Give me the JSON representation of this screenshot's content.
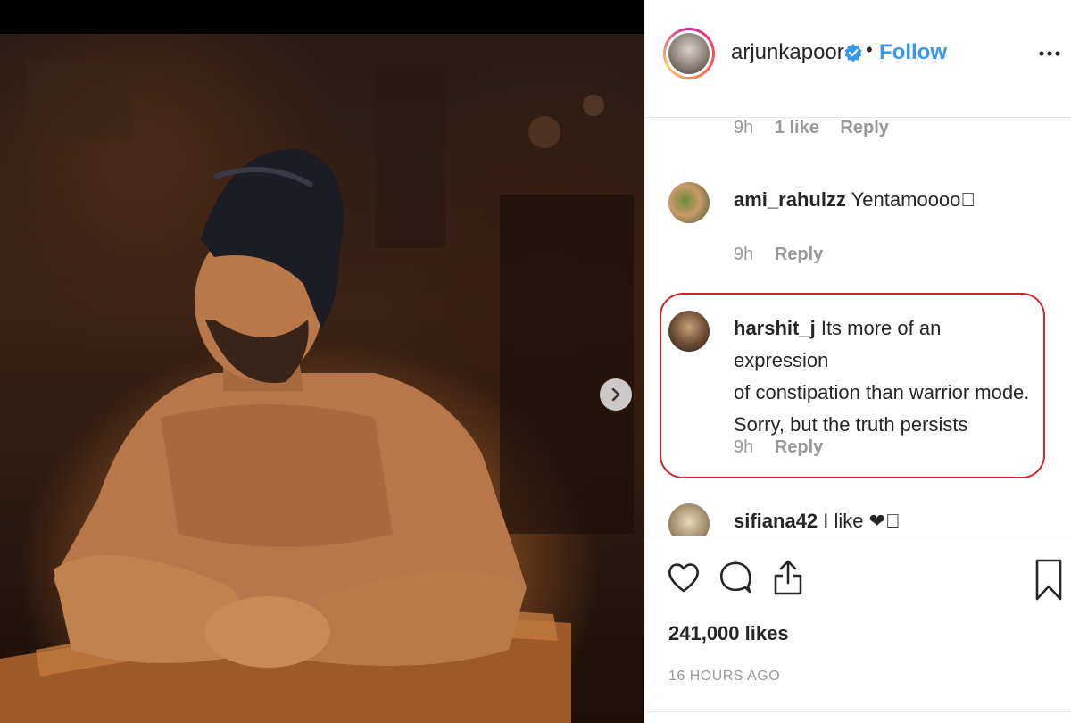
{
  "post": {
    "username": "arjunkapoor",
    "separator": "•",
    "follow_label": "Follow",
    "likes": "241,000 likes",
    "time_ago": "16 HOURS AGO"
  },
  "comments": [
    {
      "user": "",
      "text": "",
      "time": "9h",
      "likes": "1 like",
      "reply": "Reply"
    },
    {
      "user": "ami_rahulzz",
      "text": "Yentamoooo\u0000",
      "time": "9h",
      "reply": "Reply"
    },
    {
      "user": "harshit_j",
      "text_line1": "Its more of an expression",
      "text_line2": "of constipation than warrior mode.",
      "text_line3": "Sorry, but the truth persists",
      "time": "9h",
      "reply": "Reply"
    },
    {
      "user": "sifiana42",
      "text": "I like ❤\u0000"
    }
  ],
  "colors": {
    "follow": "#3897f0",
    "highlight_border": "#d3222a",
    "muted": "#999999",
    "text": "#262626"
  },
  "icons": {
    "like": "heart-icon",
    "comment": "comment-bubble-icon",
    "share": "share-icon",
    "save": "bookmark-icon",
    "more": "ellipsis-icon",
    "verified": "verified-badge-icon",
    "next": "chevron-right-icon"
  }
}
